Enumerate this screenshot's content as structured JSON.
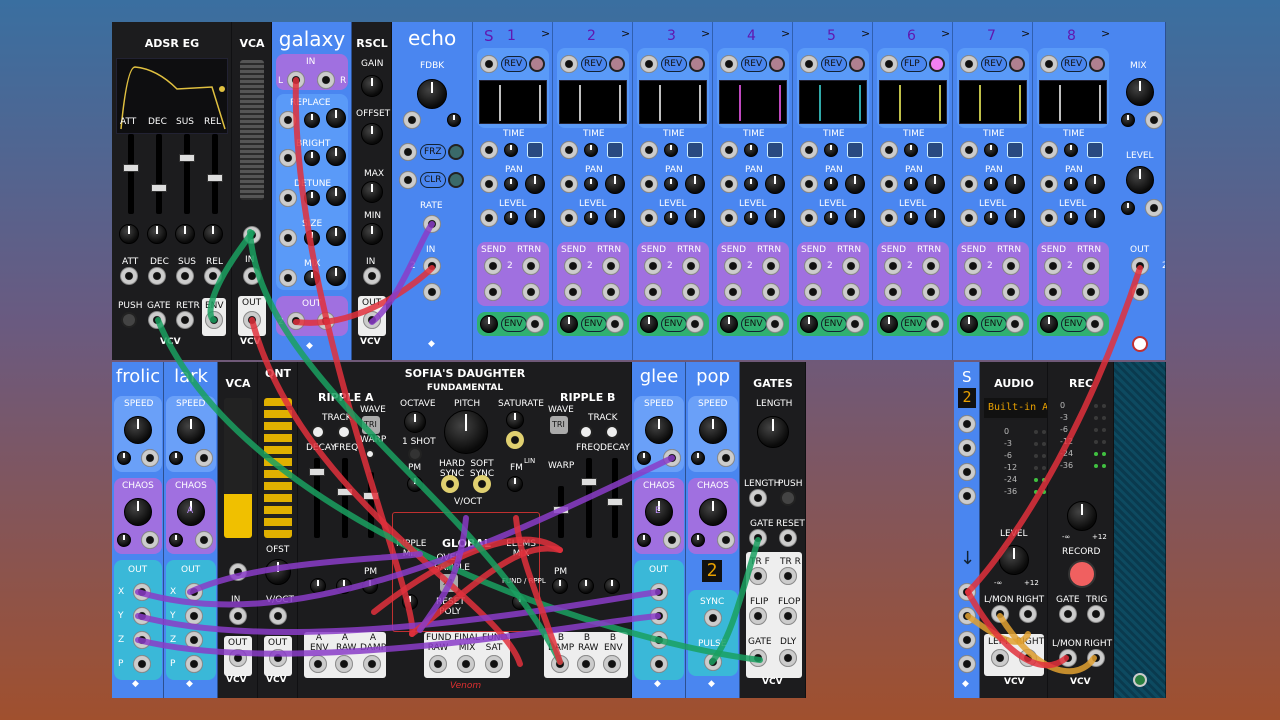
{
  "modules": {
    "adsr": {
      "title": "ADSR EG",
      "faders": [
        "ATT",
        "DEC",
        "SUS",
        "REL"
      ],
      "knobs": [
        "ATT",
        "DEC",
        "SUS",
        "REL"
      ],
      "push": "PUSH",
      "gate": "GATE",
      "retr": "RETR",
      "env": "ENV",
      "brand": "VCV"
    },
    "vca1": {
      "title": "VCA",
      "in": "IN",
      "out": "OUT",
      "brand": "VCV"
    },
    "galaxy": {
      "title": "galaxy",
      "in": "IN",
      "l": "L",
      "r": "R",
      "replace": "REPLACE",
      "bright": "BRIGHT",
      "detune": "DETUNE",
      "size": "SIZE",
      "mix": "MIX",
      "out": "OUT",
      "num": "2"
    },
    "rscl": {
      "title": "RSCL",
      "gain": "GAIN",
      "offset": "OFFSET",
      "max": "MAX",
      "min": "MIN",
      "in": "IN",
      "out": "OUT",
      "brand": "VCV"
    },
    "echo": {
      "title": "echo",
      "s": "S",
      "fdbk": "FDBK",
      "frz": "FRZ",
      "clr": "CLR",
      "rate": "RATE",
      "in": "IN",
      "in_num": "2",
      "taps": [
        {
          "num": "1",
          "mode": "REV"
        },
        {
          "num": "2",
          "mode": "REV"
        },
        {
          "num": "3",
          "mode": "REV"
        },
        {
          "num": "4",
          "mode": "REV"
        },
        {
          "num": "5",
          "mode": "REV"
        },
        {
          "num": "6",
          "mode": "FLP"
        },
        {
          "num": "7",
          "mode": "REV"
        },
        {
          "num": "8",
          "mode": "REV"
        }
      ],
      "arrow": ">",
      "time": "TIME",
      "pan": "PAN",
      "level": "LEVEL",
      "send": "SEND",
      "rtrn": "RTRN",
      "env": "ENV",
      "two": "2",
      "mix": "MIX",
      "level_r": "LEVEL",
      "out": "OUT",
      "out_num": "2"
    },
    "frolic": {
      "title": "frolic",
      "speed": "SPEED",
      "chaos": "CHAOS",
      "out": "OUT",
      "x": "X",
      "y": "Y",
      "z": "Z",
      "p": "P"
    },
    "lark": {
      "title": "lark",
      "speed": "SPEED",
      "chaos": "CHAOS",
      "a": "A",
      "out": "OUT",
      "x": "X",
      "y": "Y",
      "z": "Z",
      "p": "P"
    },
    "vca2": {
      "title": "VCA",
      "in": "IN",
      "out": "OUT",
      "brand": "VCV"
    },
    "qnt": {
      "title": "QNT",
      "ofst": "OFST",
      "voct": "V/OCT",
      "out": "OUT",
      "brand": "VCV"
    },
    "sofia": {
      "title": "SOFIA'S DAUGHTER",
      "fundamental": "FUNDAMENTAL",
      "ripple_a": "RIPPLE A",
      "ripple_b": "RIPPLE B",
      "wave": "WAVE",
      "track": "TRACK",
      "tri": "TRI",
      "decay": "DECAY",
      "freq": "FREQ",
      "warp": "WARP",
      "octave": "OCTAVE",
      "pitch": "PITCH",
      "saturate": "SATURATE",
      "one_shot": "1 SHOT",
      "hard_sync": "HARD SYNC",
      "soft_sync": "SOFT SYNC",
      "pm": "PM",
      "fm": "FM",
      "lin": "LIN",
      "voct": "V/OCT",
      "global": "GLOBAL",
      "ripple_mix": "RIPPLE MIX",
      "elems_mix": "ELEMS MIX",
      "oversample": "OVER SAMPLE",
      "x4": "x4",
      "reset_poly": "RESET POLY",
      "fund_ripple": "FUND / RPPL",
      "a_env": "A ENV",
      "a_raw": "A RAW",
      "a_damp": "A DAMP",
      "fund_raw": "FUND RAW",
      "final_mix": "FINAL MIX",
      "fund_sat": "FUND SAT",
      "b_damp": "B DAMP",
      "b_raw": "B RAW",
      "b_env": "B ENV",
      "brand": "Venom"
    },
    "glee": {
      "title": "glee",
      "speed": "SPEED",
      "chaos": "CHAOS",
      "e": "E",
      "out": "OUT"
    },
    "pop": {
      "title": "pop",
      "speed": "SPEED",
      "chaos": "CHAOS",
      "display": "2",
      "sync": "SYNC",
      "pulse": "PULSE"
    },
    "gates": {
      "title": "GATES",
      "length": "LENGTH",
      "length2": "LENGTH",
      "push": "PUSH",
      "gate": "GATE",
      "reset": "RESET",
      "tr_f": "TR F",
      "tr_r": "TR R",
      "flip": "FLIP",
      "flop": "FLOP",
      "gate2": "GATE",
      "dly": "DLY",
      "brand": "VCV"
    },
    "split": {
      "title": "S",
      "display": "2"
    },
    "audio": {
      "title": "AUDIO",
      "device": "Built-in Au",
      "db": [
        "0",
        "-3",
        "-6",
        "-12",
        "-24",
        "-36"
      ],
      "level": "LEVEL",
      "min": "-∞",
      "max": "+12",
      "lmon": "L/MON",
      "right": "RIGHT",
      "left": "LEFT",
      "right2": "RIGHT",
      "brand": "VCV"
    },
    "rec": {
      "title": "REC",
      "db": [
        "0",
        "-3",
        "-6",
        "-12",
        "-24",
        "-36"
      ],
      "min": "-∞",
      "max": "+12",
      "record": "RECORD",
      "gate": "GATE",
      "trig": "TRIG",
      "lmon": "L/MON",
      "right": "RIGHT",
      "brand": "VCV"
    }
  },
  "colors": {
    "blue_panel": "#4a86f0",
    "black_panel": "#1c1c1e",
    "cable_red": "#e0303c",
    "cable_green": "#1aa060",
    "cable_purple": "#8a3cc8",
    "cable_orange": "#e0a030",
    "tap_scope_colors": [
      "#ffffff",
      "#ffffff",
      "#ffffff",
      "#ff60ff",
      "#40e0e0",
      "#ffff60",
      "#ffff60",
      "#ffffff"
    ]
  }
}
